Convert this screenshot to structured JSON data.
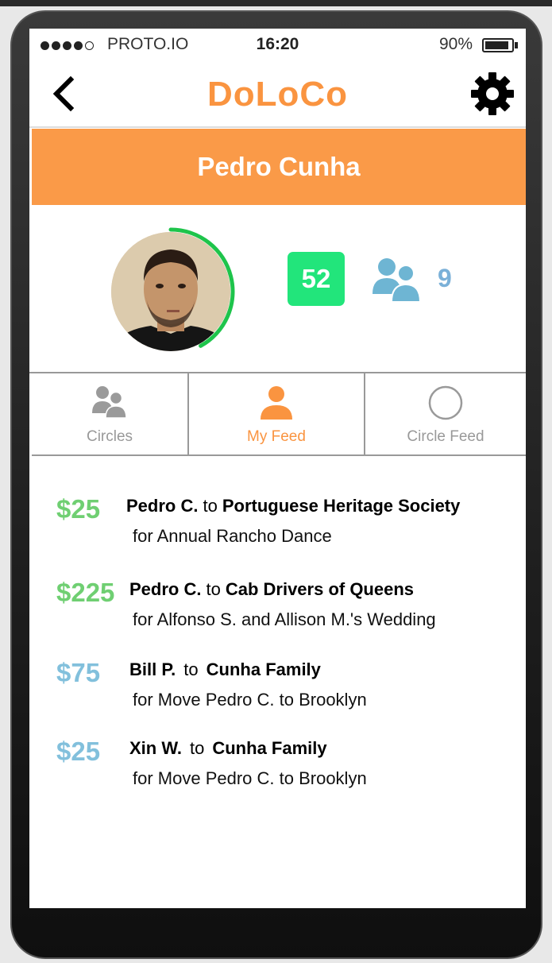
{
  "status_bar": {
    "carrier": "PROTO.IO",
    "time": "16:20",
    "battery": "90%",
    "battery_level": 0.9
  },
  "nav": {
    "title": "DoLoCo",
    "back_icon": "chevron-left-icon",
    "settings_icon": "gear-icon"
  },
  "profile": {
    "name": "Pedro Cunha",
    "score": "52",
    "circles_count": "9",
    "progress": 0.42
  },
  "tabs": [
    {
      "label": "Circles",
      "icon": "people-icon",
      "active": false
    },
    {
      "label": "My Feed",
      "icon": "person-icon",
      "active": true
    },
    {
      "label": "Circle Feed",
      "icon": "circle-icon",
      "active": false
    }
  ],
  "feed": [
    {
      "amount": "$25",
      "from": "Pedro C.",
      "to_word": "to",
      "to": "Portuguese Heritage Society",
      "purpose": "for Annual Rancho Dance",
      "amount_color": "#6fcf72"
    },
    {
      "amount": "$225",
      "from": "Pedro C.",
      "to_word": "to",
      "to": "Cab Drivers of Queens",
      "purpose": "for Alfonso S. and Allison M.'s Wedding",
      "amount_color": "#6fcf72"
    },
    {
      "amount": "$75",
      "from": "Bill P.",
      "to_word": "to",
      "to": "Cunha Family",
      "purpose": "for Move Pedro C. to Brooklyn",
      "amount_color": "#82c0dc"
    },
    {
      "amount": "$25",
      "from": "Xin W.",
      "to_word": "to",
      "to": "Cunha Family",
      "purpose": "for Move Pedro C. to Brooklyn",
      "amount_color": "#82c0dc"
    }
  ],
  "colors": {
    "brand_orange": "#fa9440",
    "banner_orange": "#fa9a48",
    "score_green": "#22e57b",
    "ring_green": "#1ec44b",
    "icon_blue": "#6eb5d3"
  }
}
